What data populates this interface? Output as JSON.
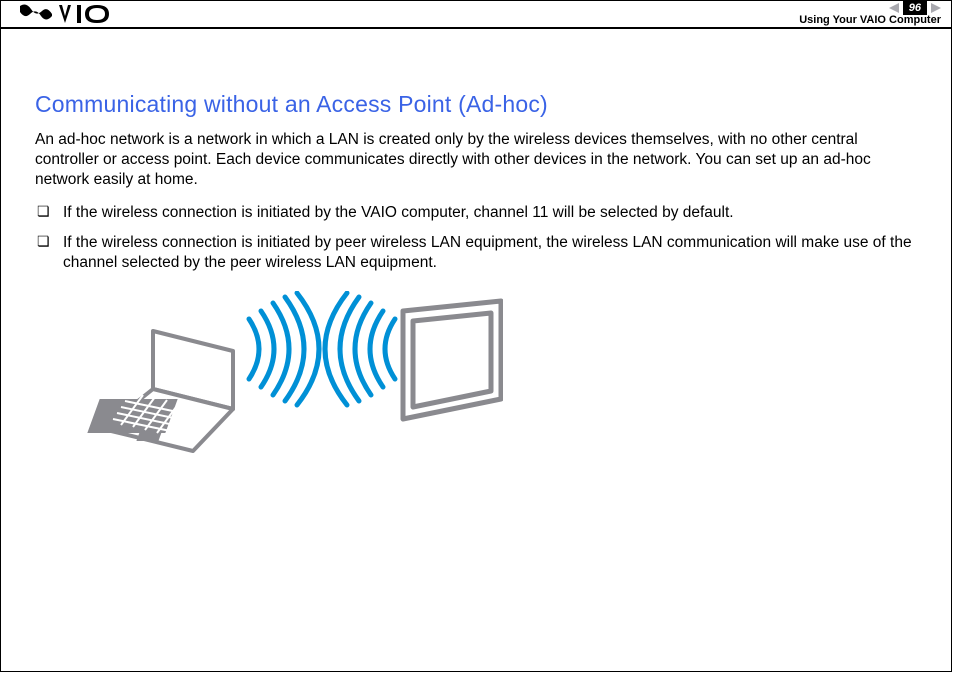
{
  "header": {
    "page_number": "96",
    "section": "Using Your VAIO Computer"
  },
  "content": {
    "title": "Communicating without an Access Point (Ad-hoc)",
    "paragraph": "An ad-hoc network is a network in which a LAN is created only by the wireless devices themselves, with no other central controller or access point. Each device communicates directly with other devices in the network. You can set up an ad-hoc network easily at home.",
    "bullets": [
      "If the wireless connection is initiated by the VAIO computer, channel 11 will be selected by default.",
      "If the wireless connection is initiated by peer wireless LAN equipment, the wireless LAN communication will make use of the channel selected by the peer wireless LAN equipment."
    ]
  },
  "logo_name": "vaio-logo",
  "illustration": {
    "description": "adhoc-wireless-illustration",
    "wave_color": "#0090d6",
    "device_color": "#8a8a8f"
  }
}
